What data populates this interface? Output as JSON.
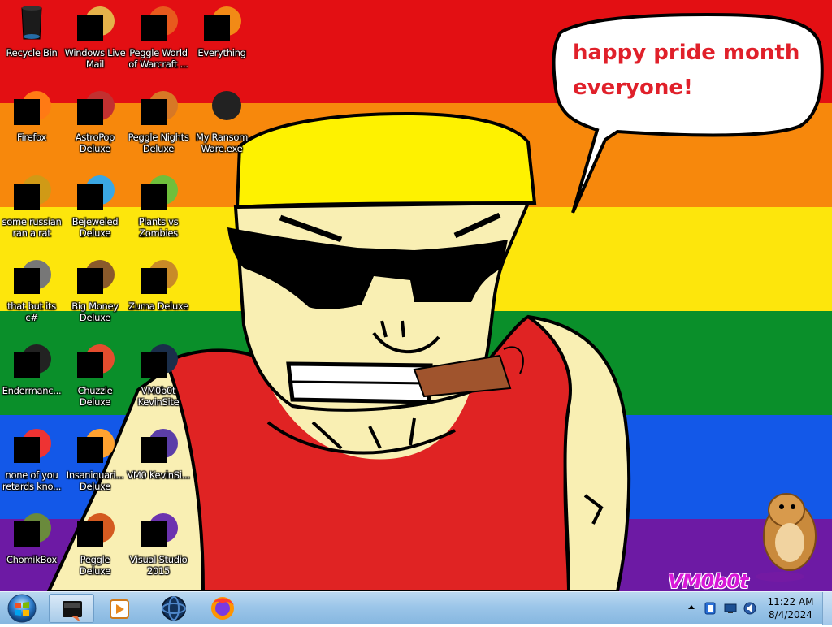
{
  "wallpaper": {
    "stripe_colors": [
      "#e30f13",
      "#f7880c",
      "#fde60c",
      "#0a8f2a",
      "#1358e8",
      "#6d1aa4"
    ],
    "speech_text": "happy pride month everyone!",
    "watermark": "VM0b0t"
  },
  "desktop_icons": [
    {
      "label": "Recycle Bin",
      "icon": "recycle-bin-icon"
    },
    {
      "label": "Windows Live Mail",
      "icon": "mail-icon"
    },
    {
      "label": "Peggle World of Warcraft ...",
      "icon": "peggle-icon"
    },
    {
      "label": "Everything",
      "icon": "search-icon"
    },
    {
      "label": "Firefox",
      "icon": "firefox-icon"
    },
    {
      "label": "AstroPop Deluxe",
      "icon": "game-icon"
    },
    {
      "label": "Peggle Nights Deluxe",
      "icon": "peggle-icon"
    },
    {
      "label": "My Ransom Ware.exe",
      "icon": "console-icon"
    },
    {
      "label": "some russian ran a rat",
      "icon": "app-icon"
    },
    {
      "label": "Bejeweled Deluxe",
      "icon": "gem-icon"
    },
    {
      "label": "Plants vs Zombies",
      "icon": "plant-icon"
    },
    {
      "label": "that but its c#",
      "icon": "window-icon"
    },
    {
      "label": "Big Money Deluxe",
      "icon": "money-bag-icon"
    },
    {
      "label": "Zuma Deluxe",
      "icon": "game-icon"
    },
    {
      "label": "Endermanc...",
      "icon": "console-icon"
    },
    {
      "label": "Chuzzle Deluxe",
      "icon": "game-icon"
    },
    {
      "label": "VM0b0t KevinSite",
      "icon": "app-icon"
    },
    {
      "label": "none of you retards kno...",
      "icon": "game-icon"
    },
    {
      "label": "Insaniquari... Deluxe",
      "icon": "fish-icon"
    },
    {
      "label": "VM0 KevinSi...",
      "icon": "app-icon"
    },
    {
      "label": "ChomikBox",
      "icon": "hamster-icon"
    },
    {
      "label": "Peggle Deluxe",
      "icon": "peggle-icon"
    },
    {
      "label": "Visual Studio 2015",
      "icon": "visual-studio-icon"
    }
  ],
  "taskbar": {
    "start_icon": "windows-logo-icon",
    "pinned": [
      "file-explorer-icon",
      "media-player-icon",
      "internet-icon",
      "firefox-icon"
    ],
    "tray_icons": [
      "show-hidden-icons-arrow",
      "app-tray-icon",
      "network-icon",
      "volume-icon"
    ],
    "clock_time": "11:22 AM",
    "clock_date": "8/4/2024"
  }
}
